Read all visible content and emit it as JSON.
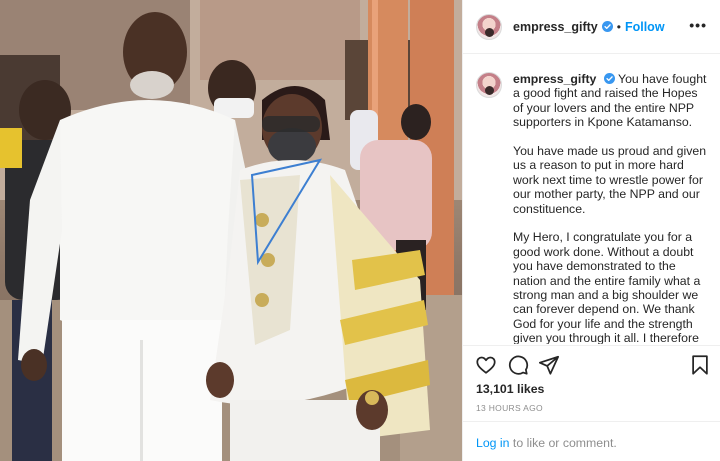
{
  "post": {
    "username": "empress_gifty",
    "verified": true,
    "follow_label": "Follow",
    "separator": "•",
    "more_label": "•••",
    "caption_paragraphs": [
      "You have fought a good fight and raised the Hopes of your lovers and the entire NPP supporters in Kpone Katamanso.",
      "You have made us proud and given us a reason to put in more hard work next time to wrestle power for our mother party, the NPP and our constituence.",
      "My Hero, I congratulate you for a good work done. Without a doubt you have demonstrated to the nation and the entire family what a strong man and a big shoulder we can forever depend on. We thank God for your life and the strength given you through it all. I therefore pledge you my full support in all your political endeavours."
    ],
    "likes": "13,101 likes",
    "time": "13 HOURS AGO",
    "comment": {
      "login_label": "Log in",
      "rest": " to like or comment."
    }
  },
  "icons": {
    "like": "heart-icon",
    "comment": "comment-icon",
    "share": "paper-plane-icon",
    "save": "bookmark-icon",
    "verified": "verified-badge-icon",
    "more": "more-options-icon"
  },
  "colors": {
    "accent": "#0095f6",
    "verified": "#3897f0",
    "text": "#262626",
    "muted": "#8e8e8e",
    "border": "#efefef"
  }
}
